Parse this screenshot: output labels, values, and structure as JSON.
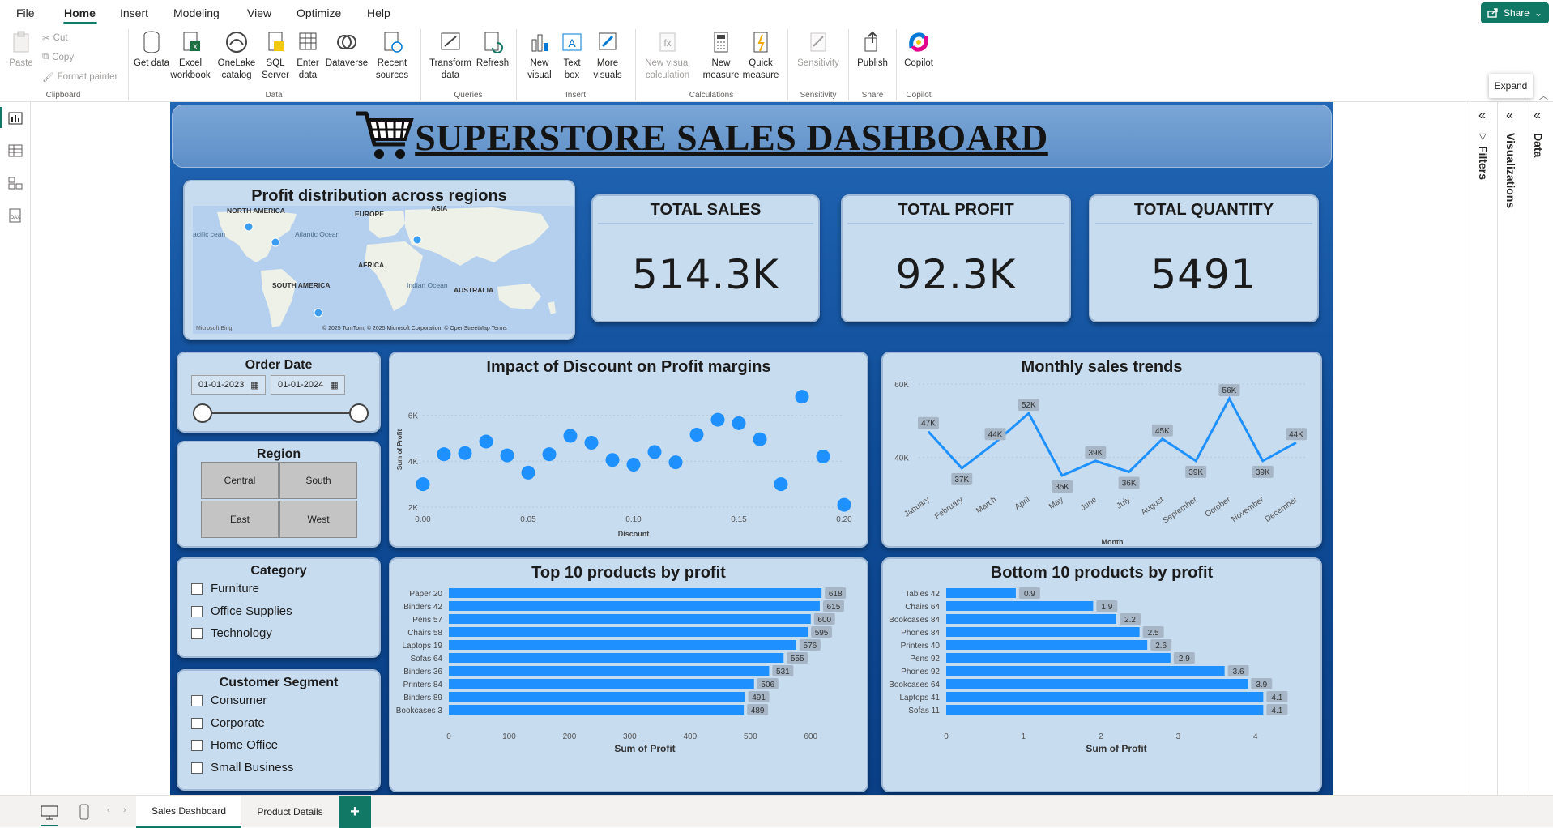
{
  "menu": {
    "items": [
      "File",
      "Home",
      "Insert",
      "Modeling",
      "View",
      "Optimize",
      "Help"
    ],
    "active": "Home",
    "share": "Share"
  },
  "ribbon": {
    "clipboard": {
      "paste": "Paste",
      "cut": "Cut",
      "copy": "Copy",
      "format_painter": "Format painter",
      "group": "Clipboard"
    },
    "data": {
      "get_data": "Get data",
      "excel": "Excel workbook",
      "onelake": "OneLake catalog",
      "sql": "SQL Server",
      "enter": "Enter data",
      "dataverse": "Dataverse",
      "recent": "Recent sources",
      "group": "Data"
    },
    "queries": {
      "transform": "Transform data",
      "refresh": "Refresh",
      "group": "Queries"
    },
    "insert": {
      "new_visual": "New visual",
      "text_box": "Text box",
      "more_visuals": "More visuals",
      "group": "Insert"
    },
    "calculations": {
      "new_visual_calc": "New visual calculation",
      "new_measure": "New measure",
      "quick_measure": "Quick measure",
      "group": "Calculations"
    },
    "sensitivity": {
      "label": "Sensitivity",
      "group": "Sensitivity"
    },
    "share": {
      "publish": "Publish",
      "group": "Share"
    },
    "copilot": {
      "label": "Copilot",
      "group": "Copilot"
    }
  },
  "right_panes": {
    "filters": "Filters",
    "visualizations": "Visualizations",
    "data": "Data",
    "tooltip": "Expand"
  },
  "dashboard": {
    "title": "SUPERSTORE SALES DASHBOARD",
    "map": {
      "title": "Profit distribution across regions",
      "labels": {
        "north_america": "NORTH AMERICA",
        "europe": "EUROPE",
        "asia": "ASIA",
        "africa": "AFRICA",
        "south_america": "SOUTH AMERICA",
        "australia": "AUSTRALIA",
        "atlantic": "Atlantic Ocean",
        "pacific": "acific cean",
        "indian": "Indian Ocean"
      },
      "attribution": "© 2025 TomTom, © 2025 Microsoft Corporation, © OpenStreetMap  Terms",
      "bing": "Microsoft Bing"
    },
    "kpis": [
      {
        "label": "TOTAL SALES",
        "value": "514.3K"
      },
      {
        "label": "TOTAL PROFIT",
        "value": "92.3K"
      },
      {
        "label": "TOTAL QUANTITY",
        "value": "5491"
      }
    ],
    "order_date": {
      "title": "Order Date",
      "start": "01-01-2023",
      "end": "01-01-2024"
    },
    "region": {
      "title": "Region",
      "options": [
        "Central",
        "South",
        "East",
        "West"
      ]
    },
    "category": {
      "title": "Category",
      "options": [
        "Furniture",
        "Office Supplies",
        "Technology"
      ]
    },
    "segment": {
      "title": "Customer Segment",
      "options": [
        "Consumer",
        "Corporate",
        "Home Office",
        "Small Business"
      ]
    }
  },
  "chart_data": [
    {
      "type": "scatter",
      "title": "Impact of Discount on Profit margins",
      "xlabel": "Discount",
      "ylabel": "Sum of Profit",
      "xlim": [
        0,
        0.2
      ],
      "ylim": [
        2000,
        7000
      ],
      "xticks": [
        "0.00",
        "0.05",
        "0.10",
        "0.15",
        "0.20"
      ],
      "yticks": [
        "2K",
        "4K",
        "6K"
      ],
      "x": [
        0.0,
        0.01,
        0.02,
        0.03,
        0.04,
        0.05,
        0.06,
        0.07,
        0.08,
        0.09,
        0.1,
        0.11,
        0.12,
        0.13,
        0.14,
        0.15,
        0.16,
        0.17,
        0.18,
        0.19,
        0.2
      ],
      "y": [
        3000,
        4300,
        4350,
        4850,
        4250,
        3500,
        4300,
        5100,
        4800,
        4050,
        3850,
        4400,
        3950,
        5150,
        5800,
        5650,
        4950,
        3000,
        6800,
        4200,
        2100
      ]
    },
    {
      "type": "line",
      "title": "Monthly sales trends",
      "xlabel": "Month",
      "ylabel": "",
      "ylim": [
        33,
        60
      ],
      "yticks": [
        "40K",
        "60K"
      ],
      "categories": [
        "January",
        "February",
        "March",
        "April",
        "May",
        "June",
        "July",
        "August",
        "September",
        "October",
        "November",
        "December"
      ],
      "values": [
        47,
        37,
        44,
        52,
        35,
        39,
        36,
        45,
        39,
        56,
        39,
        44
      ],
      "labels": [
        "47K",
        "37K",
        "44K",
        "52K",
        "35K",
        "39K",
        "36K",
        "45K",
        "39K",
        "56K",
        "39K",
        "44K"
      ]
    },
    {
      "type": "bar",
      "title": "Top 10 products by profit",
      "xlabel": "Sum of Profit",
      "xlim": [
        0,
        650
      ],
      "xticks": [
        "0",
        "100",
        "200",
        "300",
        "400",
        "500",
        "600"
      ],
      "categories": [
        "Paper 20",
        "Binders 42",
        "Pens 57",
        "Chairs 58",
        "Laptops 19",
        "Sofas 64",
        "Binders 36",
        "Printers 84",
        "Binders 89",
        "Bookcases 3"
      ],
      "values": [
        618,
        615,
        600,
        595,
        576,
        555,
        531,
        506,
        491,
        489
      ]
    },
    {
      "type": "bar",
      "title": "Bottom 10 products by profit",
      "xlabel": "Sum of Profit",
      "xlim": [
        0,
        4.4
      ],
      "xticks": [
        "0",
        "1",
        "2",
        "3",
        "4"
      ],
      "categories": [
        "Tables 42",
        "Chairs 64",
        "Bookcases 84",
        "Phones 84",
        "Printers 40",
        "Pens 92",
        "Phones 92",
        "Bookcases 64",
        "Laptops 41",
        "Sofas 11"
      ],
      "values": [
        0.9,
        1.9,
        2.2,
        2.5,
        2.6,
        2.9,
        3.6,
        3.9,
        4.1,
        4.1
      ]
    }
  ],
  "tabs": {
    "items": [
      "Sales Dashboard",
      "Product Details"
    ],
    "active": "Sales Dashboard"
  },
  "colors": {
    "accent": "#117865",
    "bar": "#1e90ff",
    "report_bg": "#0f4c97",
    "card": "#c8dcef"
  }
}
